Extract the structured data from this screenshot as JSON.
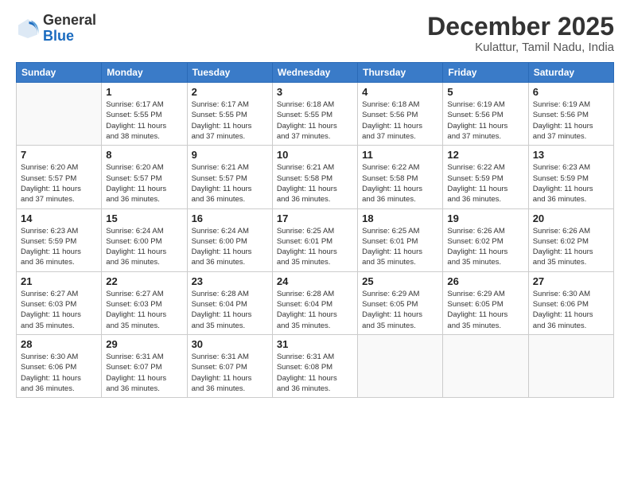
{
  "logo": {
    "general": "General",
    "blue": "Blue"
  },
  "header": {
    "month": "December 2025",
    "location": "Kulattur, Tamil Nadu, India"
  },
  "weekdays": [
    "Sunday",
    "Monday",
    "Tuesday",
    "Wednesday",
    "Thursday",
    "Friday",
    "Saturday"
  ],
  "weeks": [
    [
      {
        "day": "",
        "info": ""
      },
      {
        "day": "1",
        "info": "Sunrise: 6:17 AM\nSunset: 5:55 PM\nDaylight: 11 hours\nand 38 minutes."
      },
      {
        "day": "2",
        "info": "Sunrise: 6:17 AM\nSunset: 5:55 PM\nDaylight: 11 hours\nand 37 minutes."
      },
      {
        "day": "3",
        "info": "Sunrise: 6:18 AM\nSunset: 5:55 PM\nDaylight: 11 hours\nand 37 minutes."
      },
      {
        "day": "4",
        "info": "Sunrise: 6:18 AM\nSunset: 5:56 PM\nDaylight: 11 hours\nand 37 minutes."
      },
      {
        "day": "5",
        "info": "Sunrise: 6:19 AM\nSunset: 5:56 PM\nDaylight: 11 hours\nand 37 minutes."
      },
      {
        "day": "6",
        "info": "Sunrise: 6:19 AM\nSunset: 5:56 PM\nDaylight: 11 hours\nand 37 minutes."
      }
    ],
    [
      {
        "day": "7",
        "info": "Sunrise: 6:20 AM\nSunset: 5:57 PM\nDaylight: 11 hours\nand 37 minutes."
      },
      {
        "day": "8",
        "info": "Sunrise: 6:20 AM\nSunset: 5:57 PM\nDaylight: 11 hours\nand 36 minutes."
      },
      {
        "day": "9",
        "info": "Sunrise: 6:21 AM\nSunset: 5:57 PM\nDaylight: 11 hours\nand 36 minutes."
      },
      {
        "day": "10",
        "info": "Sunrise: 6:21 AM\nSunset: 5:58 PM\nDaylight: 11 hours\nand 36 minutes."
      },
      {
        "day": "11",
        "info": "Sunrise: 6:22 AM\nSunset: 5:58 PM\nDaylight: 11 hours\nand 36 minutes."
      },
      {
        "day": "12",
        "info": "Sunrise: 6:22 AM\nSunset: 5:59 PM\nDaylight: 11 hours\nand 36 minutes."
      },
      {
        "day": "13",
        "info": "Sunrise: 6:23 AM\nSunset: 5:59 PM\nDaylight: 11 hours\nand 36 minutes."
      }
    ],
    [
      {
        "day": "14",
        "info": "Sunrise: 6:23 AM\nSunset: 5:59 PM\nDaylight: 11 hours\nand 36 minutes."
      },
      {
        "day": "15",
        "info": "Sunrise: 6:24 AM\nSunset: 6:00 PM\nDaylight: 11 hours\nand 36 minutes."
      },
      {
        "day": "16",
        "info": "Sunrise: 6:24 AM\nSunset: 6:00 PM\nDaylight: 11 hours\nand 36 minutes."
      },
      {
        "day": "17",
        "info": "Sunrise: 6:25 AM\nSunset: 6:01 PM\nDaylight: 11 hours\nand 35 minutes."
      },
      {
        "day": "18",
        "info": "Sunrise: 6:25 AM\nSunset: 6:01 PM\nDaylight: 11 hours\nand 35 minutes."
      },
      {
        "day": "19",
        "info": "Sunrise: 6:26 AM\nSunset: 6:02 PM\nDaylight: 11 hours\nand 35 minutes."
      },
      {
        "day": "20",
        "info": "Sunrise: 6:26 AM\nSunset: 6:02 PM\nDaylight: 11 hours\nand 35 minutes."
      }
    ],
    [
      {
        "day": "21",
        "info": "Sunrise: 6:27 AM\nSunset: 6:03 PM\nDaylight: 11 hours\nand 35 minutes."
      },
      {
        "day": "22",
        "info": "Sunrise: 6:27 AM\nSunset: 6:03 PM\nDaylight: 11 hours\nand 35 minutes."
      },
      {
        "day": "23",
        "info": "Sunrise: 6:28 AM\nSunset: 6:04 PM\nDaylight: 11 hours\nand 35 minutes."
      },
      {
        "day": "24",
        "info": "Sunrise: 6:28 AM\nSunset: 6:04 PM\nDaylight: 11 hours\nand 35 minutes."
      },
      {
        "day": "25",
        "info": "Sunrise: 6:29 AM\nSunset: 6:05 PM\nDaylight: 11 hours\nand 35 minutes."
      },
      {
        "day": "26",
        "info": "Sunrise: 6:29 AM\nSunset: 6:05 PM\nDaylight: 11 hours\nand 35 minutes."
      },
      {
        "day": "27",
        "info": "Sunrise: 6:30 AM\nSunset: 6:06 PM\nDaylight: 11 hours\nand 36 minutes."
      }
    ],
    [
      {
        "day": "28",
        "info": "Sunrise: 6:30 AM\nSunset: 6:06 PM\nDaylight: 11 hours\nand 36 minutes."
      },
      {
        "day": "29",
        "info": "Sunrise: 6:31 AM\nSunset: 6:07 PM\nDaylight: 11 hours\nand 36 minutes."
      },
      {
        "day": "30",
        "info": "Sunrise: 6:31 AM\nSunset: 6:07 PM\nDaylight: 11 hours\nand 36 minutes."
      },
      {
        "day": "31",
        "info": "Sunrise: 6:31 AM\nSunset: 6:08 PM\nDaylight: 11 hours\nand 36 minutes."
      },
      {
        "day": "",
        "info": ""
      },
      {
        "day": "",
        "info": ""
      },
      {
        "day": "",
        "info": ""
      }
    ]
  ]
}
